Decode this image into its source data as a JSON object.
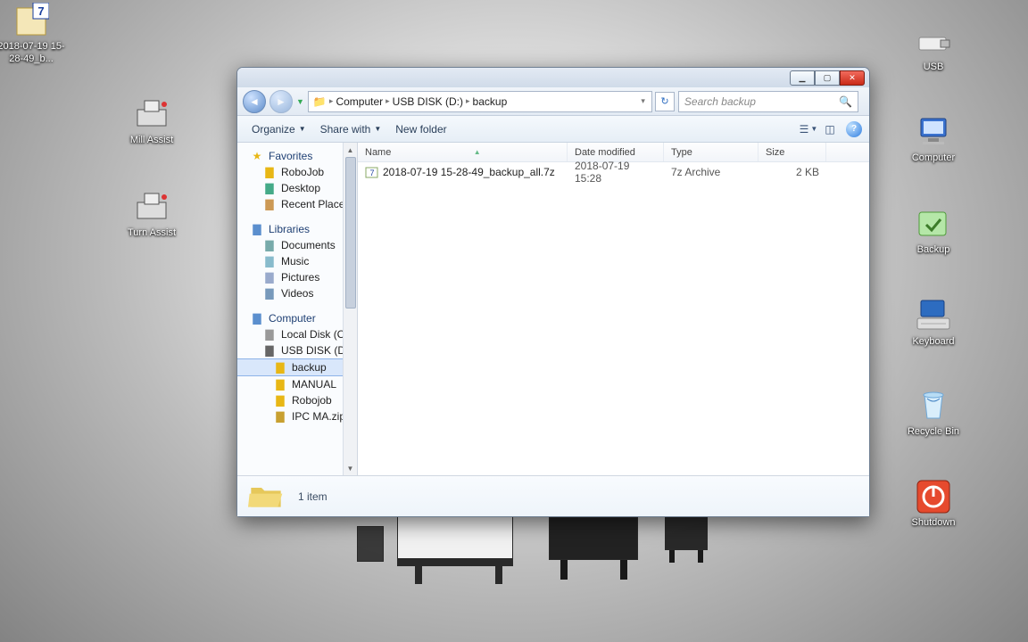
{
  "desktop": {
    "left_icons": [
      {
        "id": "archive",
        "label": "2018-07-19\n15-28-49_b...",
        "icon": "7z"
      },
      {
        "id": "mill",
        "label": "Mill Assist",
        "icon": "machine"
      },
      {
        "id": "turn",
        "label": "Turn Assist",
        "icon": "machine"
      }
    ],
    "right_icons": [
      {
        "id": "usb",
        "label": "USB",
        "icon": "usb"
      },
      {
        "id": "computer",
        "label": "Computer",
        "icon": "computer"
      },
      {
        "id": "backup",
        "label": "Backup",
        "icon": "backup"
      },
      {
        "id": "keyboard",
        "label": "Keyboard",
        "icon": "keyboard"
      },
      {
        "id": "recycle",
        "label": "Recycle Bin",
        "icon": "recycle"
      },
      {
        "id": "shutdown",
        "label": "Shutdown",
        "icon": "shutdown"
      }
    ]
  },
  "window": {
    "breadcrumb": [
      "Computer",
      "USB DISK (D:)",
      "backup"
    ],
    "search_placeholder": "Search backup",
    "toolbar": {
      "organize": "Organize",
      "share": "Share with",
      "newfolder": "New folder"
    },
    "nav": {
      "favorites": {
        "hdr": "Favorites",
        "items": [
          "RoboJob",
          "Desktop",
          "Recent Places"
        ]
      },
      "libraries": {
        "hdr": "Libraries",
        "items": [
          "Documents",
          "Music",
          "Pictures",
          "Videos"
        ]
      },
      "computer": {
        "hdr": "Computer",
        "items": [
          "Local Disk (C:)",
          "USB DISK (D:)"
        ],
        "usb_children": [
          "backup",
          "MANUAL",
          "Robojob",
          "IPC MA.zip"
        ]
      }
    },
    "columns": {
      "name": "Name",
      "date": "Date modified",
      "type": "Type",
      "size": "Size"
    },
    "col_widths": {
      "name": 235,
      "date": 108,
      "type": 106,
      "size": 76
    },
    "files": [
      {
        "name": "2018-07-19 15-28-49_backup_all.7z",
        "date": "2018-07-19 15:28",
        "type": "7z Archive",
        "size": "2 KB"
      }
    ],
    "details": {
      "count": "1 item"
    }
  }
}
